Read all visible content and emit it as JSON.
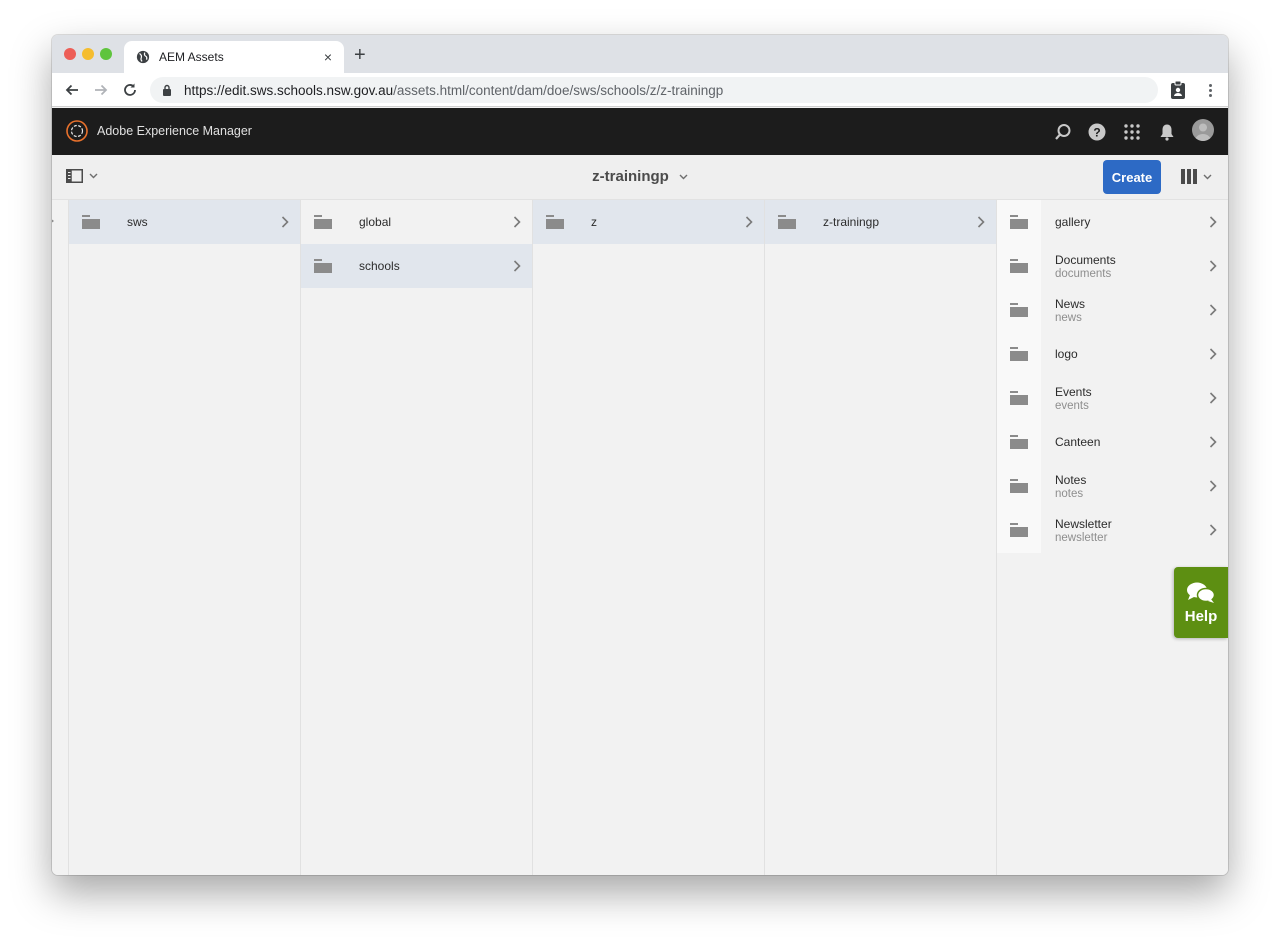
{
  "browser": {
    "tab_title": "AEM Assets",
    "tab_icon": "globe-icon",
    "new_tab_label": "+",
    "close_label": "×",
    "url_host": "https://edit.sws.schools.nsw.gov.au",
    "url_path": "/assets.html/content/dam/doe/sws/schools/z/z-trainingp"
  },
  "shell": {
    "product_name": "Adobe Experience Manager",
    "icons": [
      "search-icon",
      "help-icon",
      "solutions-grid-icon",
      "notifications-bell-icon",
      "user-avatar"
    ]
  },
  "actionbar": {
    "rail_toggle_icon": "side-panel-icon",
    "current_folder": "z-trainingp",
    "create_label": "Create",
    "view_icon": "column-view-icon",
    "accent_color": "#2d6ac5"
  },
  "columns": [
    {
      "items": [
        {
          "title": "sws",
          "subtitle": "",
          "active": true
        }
      ]
    },
    {
      "items": [
        {
          "title": "global",
          "subtitle": "",
          "active": false
        },
        {
          "title": "schools",
          "subtitle": "",
          "active": true
        }
      ]
    },
    {
      "items": [
        {
          "title": "z",
          "subtitle": "",
          "active": true
        }
      ]
    },
    {
      "items": [
        {
          "title": "z-trainingp",
          "subtitle": "",
          "active": true
        }
      ]
    },
    {
      "items": [
        {
          "title": "gallery",
          "subtitle": "",
          "active": false
        },
        {
          "title": "Documents",
          "subtitle": "documents",
          "active": false
        },
        {
          "title": "News",
          "subtitle": "news",
          "active": false
        },
        {
          "title": "logo",
          "subtitle": "",
          "active": false
        },
        {
          "title": "Events",
          "subtitle": "events",
          "active": false
        },
        {
          "title": "Canteen",
          "subtitle": "",
          "active": false
        },
        {
          "title": "Notes",
          "subtitle": "notes",
          "active": false
        },
        {
          "title": "Newsletter",
          "subtitle": "newsletter",
          "active": false
        }
      ]
    }
  ],
  "help_widget": {
    "label": "Help",
    "color": "#5d8f12"
  }
}
